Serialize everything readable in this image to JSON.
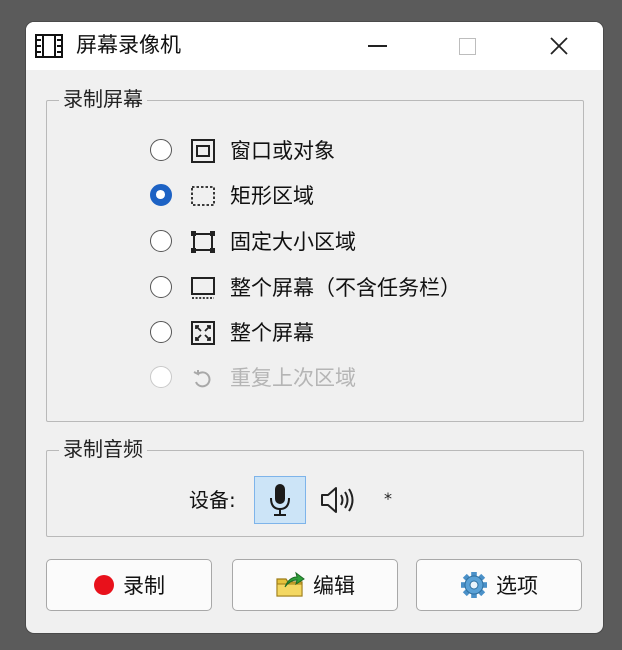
{
  "window": {
    "title": "屏幕录像机"
  },
  "screen_group": {
    "title": "录制屏幕",
    "options": [
      {
        "label": "窗口或对象",
        "icon": "window-frame-icon",
        "selected": false,
        "enabled": true
      },
      {
        "label": "矩形区域",
        "icon": "dashed-rectangle-icon",
        "selected": true,
        "enabled": true
      },
      {
        "label": "固定大小区域",
        "icon": "fixed-size-region-icon",
        "selected": false,
        "enabled": true
      },
      {
        "label": "整个屏幕（不含任务栏）",
        "icon": "screen-without-taskbar-icon",
        "selected": false,
        "enabled": true
      },
      {
        "label": "整个屏幕",
        "icon": "fullscreen-icon",
        "selected": false,
        "enabled": true
      },
      {
        "label": "重复上次区域",
        "icon": "repeat-arrow-icon",
        "selected": false,
        "enabled": false
      }
    ]
  },
  "audio_group": {
    "title": "录制音频",
    "device_label": "设备:",
    "microphone_icon": "microphone-icon",
    "speaker_icon": "speaker-icon",
    "extra_glyph": "*"
  },
  "buttons": {
    "record": "录制",
    "edit": "编辑",
    "options": "选项"
  },
  "colors": {
    "accent": "#1d62c4",
    "record_dot": "#e8111b",
    "mic_highlight": "#cce4f7"
  }
}
